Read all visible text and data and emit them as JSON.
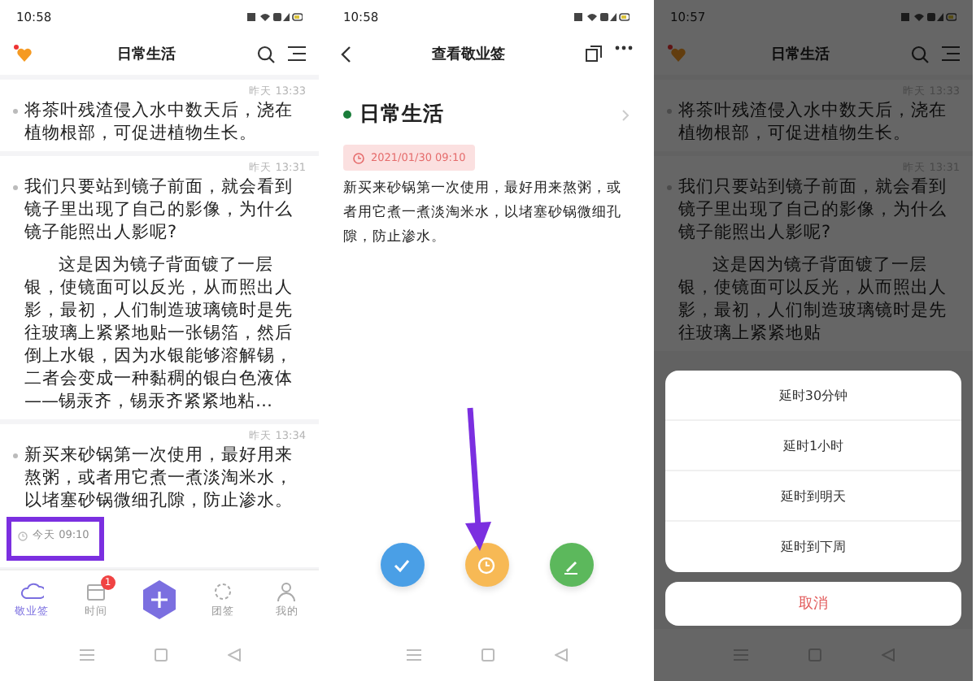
{
  "screens": [
    {
      "kind": "list",
      "status_time": "10:58",
      "title": "日常生活",
      "notes": [
        {
          "time": "昨天 13:33",
          "paragraphs": [
            "将茶叶残渣侵入水中数天后，浇在植物根部，可促进植物生长。"
          ]
        },
        {
          "time": "昨天 13:31",
          "paragraphs": [
            "我们只要站到镜子前面，就会看到镜子里出现了自己的影像，为什么镜子能照出人影呢?",
            "这是因为镜子背面镀了一层银，使镜面可以反光，从而照出人影，最初，人们制造玻璃镜时是先往玻璃上紧紧地贴一张锡箔，然后倒上水银，因为水银能够溶解锡，二者会变成一种黏稠的银白色液体——锡汞齐，锡汞齐紧紧地粘…"
          ]
        },
        {
          "time": "昨天 13:34",
          "paragraphs": [
            "新买来砂锅第一次使用，最好用来熬粥，或者用它煮一煮淡淘米水，以堵塞砂锅微细孔隙，防止渗水。"
          ],
          "reminder": "今天 09:10"
        }
      ],
      "tabs": [
        {
          "kind": "cloud",
          "label": "敬业签",
          "selected": true
        },
        {
          "kind": "calendar",
          "label": "时间",
          "selected": false,
          "badge": "1"
        },
        {
          "kind": "add",
          "selected": false
        },
        {
          "kind": "group",
          "label": "团签",
          "selected": false
        },
        {
          "kind": "person",
          "label": "我的",
          "selected": false
        }
      ]
    },
    {
      "kind": "detail",
      "status_time": "10:58",
      "title": "查看敬业签",
      "category": "日常生活",
      "date": "2021/01/30 09:10",
      "body": "新买来砂锅第一次使用，最好用来熬粥，或者用它煮一煮淡淘米水，以堵塞砂锅微细孔隙，防止渗水。",
      "actions": [
        {
          "kind": "check",
          "color": "#4a9fe6"
        },
        {
          "kind": "clock",
          "color": "#f7b955"
        },
        {
          "kind": "pencil",
          "color": "#5cb85c"
        }
      ]
    },
    {
      "kind": "sheet",
      "status_time": "10:57",
      "title": "日常生活",
      "notes": [
        {
          "time": "昨天 13:33",
          "paragraphs": [
            "将茶叶残渣侵入水中数天后，浇在植物根部，可促进植物生长。"
          ]
        },
        {
          "time": "昨天 13:31",
          "paragraphs": [
            "我们只要站到镜子前面，就会看到镜子里出现了自己的影像，为什么镜子能照出人影呢?",
            "这是因为镜子背面镀了一层银，使镜面可以反光，从而照出人影，最初，人们制造玻璃镜时是先往玻璃上紧紧地贴"
          ]
        }
      ],
      "options": [
        "延时30分钟",
        "延时1小时",
        "延时到明天",
        "延时到下周"
      ],
      "cancel": "取消"
    }
  ]
}
